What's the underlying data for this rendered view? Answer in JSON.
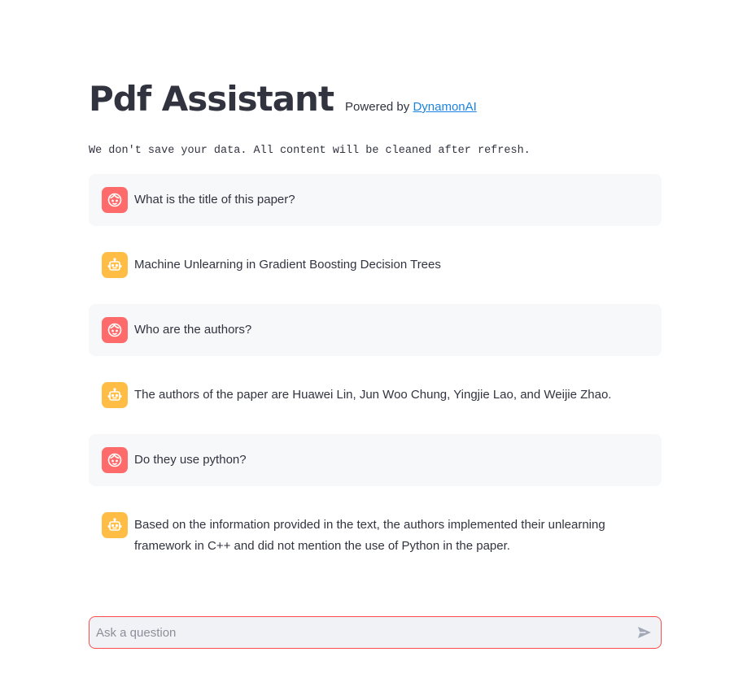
{
  "header": {
    "title": "Pdf Assistant",
    "powered_prefix": "Powered by ",
    "powered_link": "DynamonAI"
  },
  "notice": "We don't save your data. All content will be cleaned after refresh.",
  "messages": [
    {
      "role": "user",
      "icon": "user-face-icon",
      "text": "What is the title of this paper?"
    },
    {
      "role": "assistant",
      "icon": "robot-icon",
      "text": "Machine Unlearning in Gradient Boosting Decision Trees"
    },
    {
      "role": "user",
      "icon": "user-face-icon",
      "text": "Who are the authors?"
    },
    {
      "role": "assistant",
      "icon": "robot-icon",
      "text": "The authors of the paper are Huawei Lin, Jun Woo Chung, Yingjie Lao, and Weijie Zhao."
    },
    {
      "role": "user",
      "icon": "user-face-icon",
      "text": "Do they use python?"
    },
    {
      "role": "assistant",
      "icon": "robot-icon",
      "text": "Based on the information provided in the text, the authors implemented their unlearning framework in C++ and did not mention the use of Python in the paper."
    }
  ],
  "chat_input": {
    "value": "",
    "placeholder": "Ask a question",
    "send_icon": "send-icon"
  },
  "colors": {
    "user_avatar": "#ff6b6b",
    "assistant_avatar": "#ffbd45",
    "link": "#1c83e1",
    "input_border": "#ff4b4b",
    "user_bubble": "#f7f8fa"
  }
}
